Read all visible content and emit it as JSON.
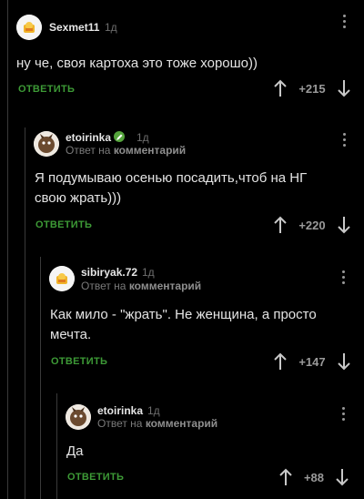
{
  "comments": [
    {
      "username": "Sexmet11",
      "time": "1д",
      "text": "ну че, своя картоха это тоже хорошо))",
      "reply_label": "ОТВЕТИТЬ",
      "rating": "+215",
      "avatar": "sun-avatar-icon"
    },
    {
      "username": "etoirinka",
      "time": "1д",
      "reply_prefix": "Ответ на",
      "reply_target": "комментарий",
      "text": "Я подумываю осенью посадить,чтоб на НГ свою жрать)))",
      "reply_label": "ОТВЕТИТЬ",
      "rating": "+220",
      "avatar": "pet-avatar-icon",
      "badge_icon": "pencil-badge-icon",
      "badge_color": "#55a43c"
    },
    {
      "username": "sibiryak.72",
      "time": "1д",
      "reply_prefix": "Ответ на",
      "reply_target": "комментарий",
      "text": "Как мило - \"жрать\". Не женщина, а просто мечта.",
      "reply_label": "ОТВЕТИТЬ",
      "rating": "+147",
      "avatar": "sun-avatar-icon"
    },
    {
      "username": "etoirinka",
      "time": "1д",
      "reply_prefix": "Ответ на",
      "reply_target": "комментарий",
      "text": "Да",
      "reply_label": "ОТВЕТИТЬ",
      "rating": "+88",
      "avatar": "pet-avatar-icon"
    }
  ],
  "colors": {
    "background": "#000000",
    "accent_green": "#3d9a36",
    "muted": "#9a9a9a"
  }
}
